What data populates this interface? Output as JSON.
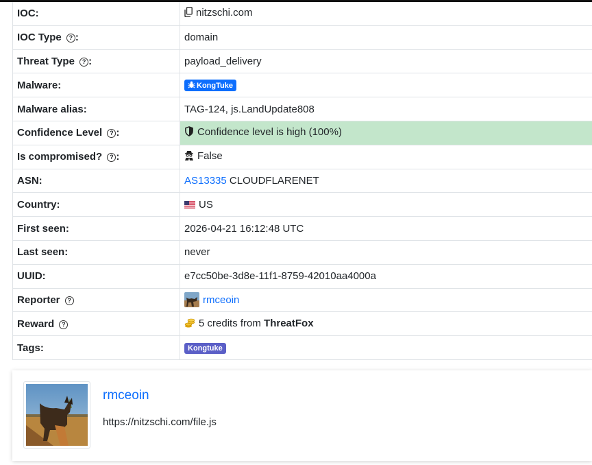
{
  "rows": {
    "ioc": {
      "label": "IOC:",
      "value": "nitzschi.com"
    },
    "ioc_type": {
      "label": "IOC Type",
      "suffix": ":",
      "value": "domain"
    },
    "threat_type": {
      "label": "Threat Type",
      "suffix": ":",
      "value": "payload_delivery"
    },
    "malware": {
      "label": "Malware:",
      "badge": "KongTuke"
    },
    "malware_alias": {
      "label": "Malware alias:",
      "value": "TAG-124, js.LandUpdate808"
    },
    "confidence": {
      "label": "Confidence Level",
      "suffix": ":",
      "value": "Confidence level is high (100%)"
    },
    "compromised": {
      "label": "Is compromised?",
      "suffix": ":",
      "value": "False"
    },
    "asn": {
      "label": "ASN:",
      "asn_link": "AS13335",
      "asn_name": "CLOUDFLARENET"
    },
    "country": {
      "label": "Country:",
      "value": "US"
    },
    "first_seen": {
      "label": "First seen:",
      "value": "2026-04-21 16:12:48 UTC"
    },
    "last_seen": {
      "label": "Last seen:",
      "value": "never"
    },
    "uuid": {
      "label": "UUID:",
      "value": "e7cc50be-3d8e-11f1-8759-42010aa4000a"
    },
    "reporter": {
      "label": "Reporter",
      "value": "rmceoin"
    },
    "reward": {
      "label": "Reward",
      "prefix": "5 credits from",
      "source": "ThreatFox"
    },
    "tags": {
      "label": "Tags:",
      "tag": "Kongtuke"
    }
  },
  "help_glyph": "?",
  "comment": {
    "author": "rmceoin",
    "text": "https://nitzschi.com/file.js"
  },
  "icons": [
    "copy-icon",
    "help-icon",
    "bug-icon",
    "shield-icon",
    "spy-icon",
    "us-flag-icon",
    "avatar",
    "coins-icon"
  ],
  "colors": {
    "link": "#0d6efd",
    "success_bg": "#c3e6cb",
    "badge": "#0d6efd",
    "tag": "#5b5fc7"
  }
}
